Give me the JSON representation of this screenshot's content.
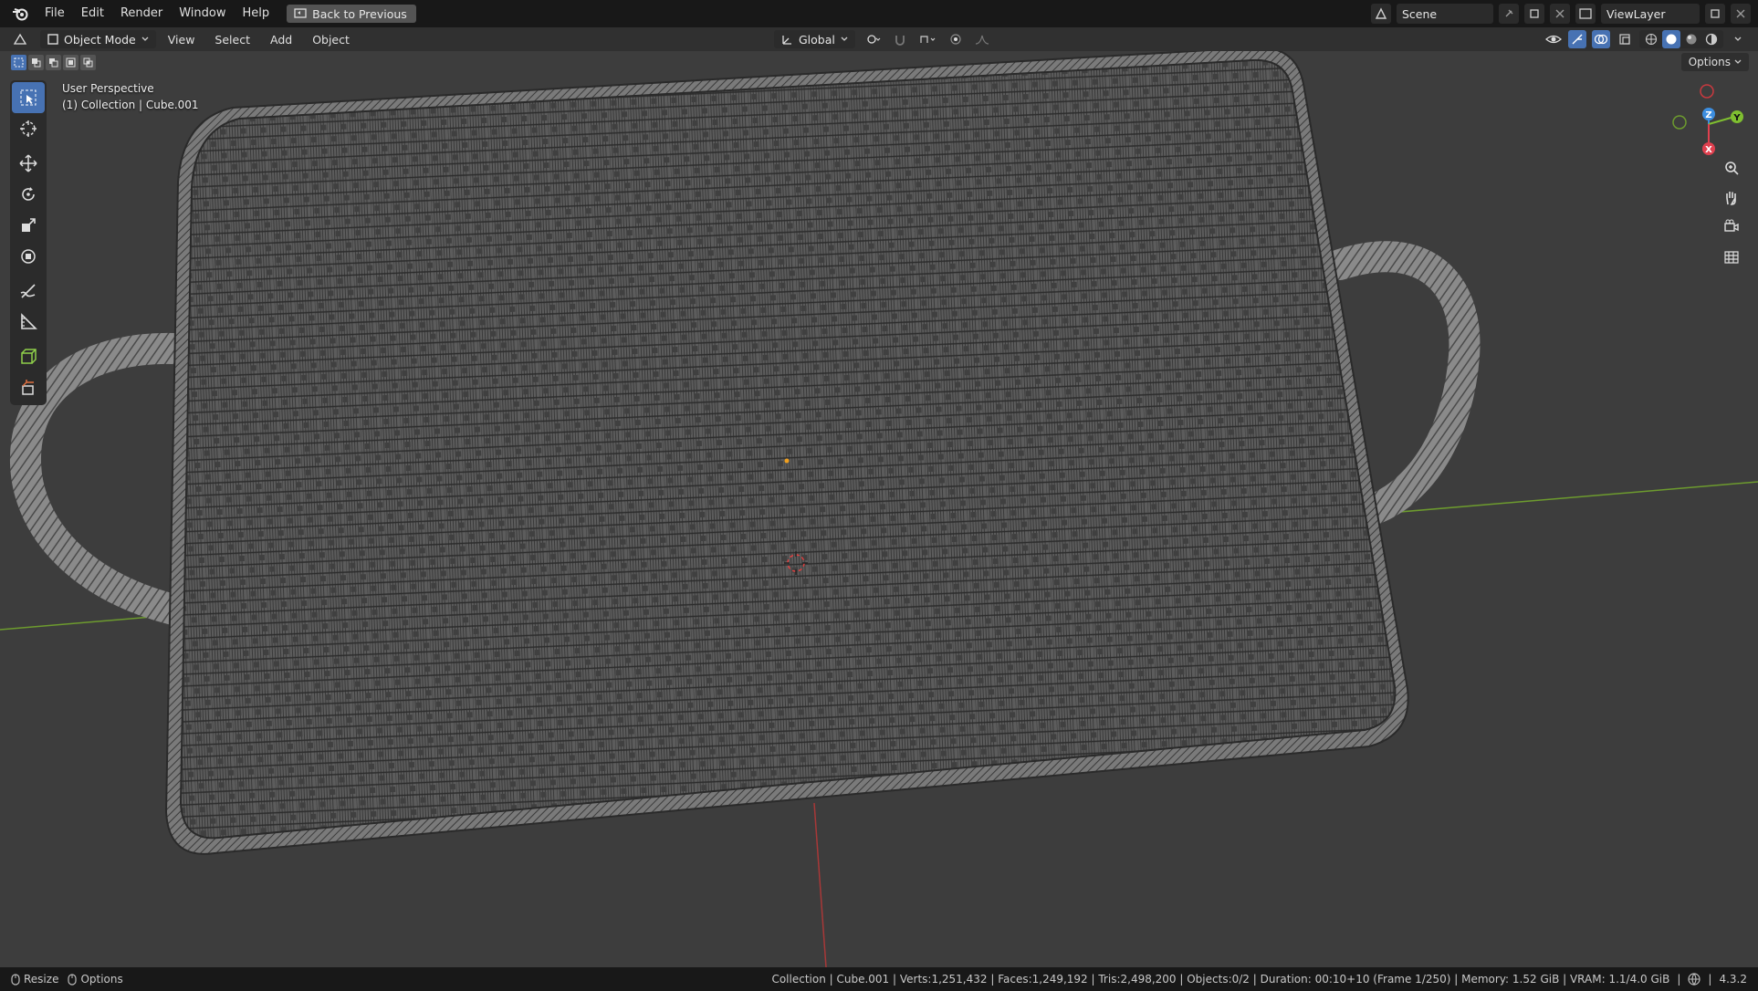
{
  "topbar": {
    "menu": [
      "File",
      "Edit",
      "Render",
      "Window",
      "Help"
    ],
    "back_button": "Back to Previous",
    "scene": "Scene",
    "view_layer": "ViewLayer"
  },
  "header": {
    "mode": "Object Mode",
    "menu": [
      "View",
      "Select",
      "Add",
      "Object"
    ],
    "transform_orientation": "Global",
    "options": "Options"
  },
  "viewport": {
    "perspective": "User Perspective",
    "collection_info": "(1) Collection | Cube.001",
    "gizmo_axes": {
      "x": "X",
      "y": "Y",
      "z": "Z"
    }
  },
  "statusbar": {
    "left": [
      {
        "icon": "mouse-icon",
        "label": "Resize"
      },
      {
        "icon": "mouse-icon",
        "label": "Options"
      }
    ],
    "info": "Collection | Cube.001 | Verts:1,251,432 | Faces:1,249,192 | Tris:2,498,200 | Objects:0/2 | Duration: 00:10+10 (Frame 1/250) | Memory: 1.52 GiB | VRAM: 1.1/4.0 GiB",
    "version": "4.3.2"
  },
  "colors": {
    "accent": "#4772b3",
    "axis_x": "#e0404f",
    "axis_y": "#7fbf30",
    "axis_z": "#3c8ee0",
    "background": "#3d3d3d"
  }
}
